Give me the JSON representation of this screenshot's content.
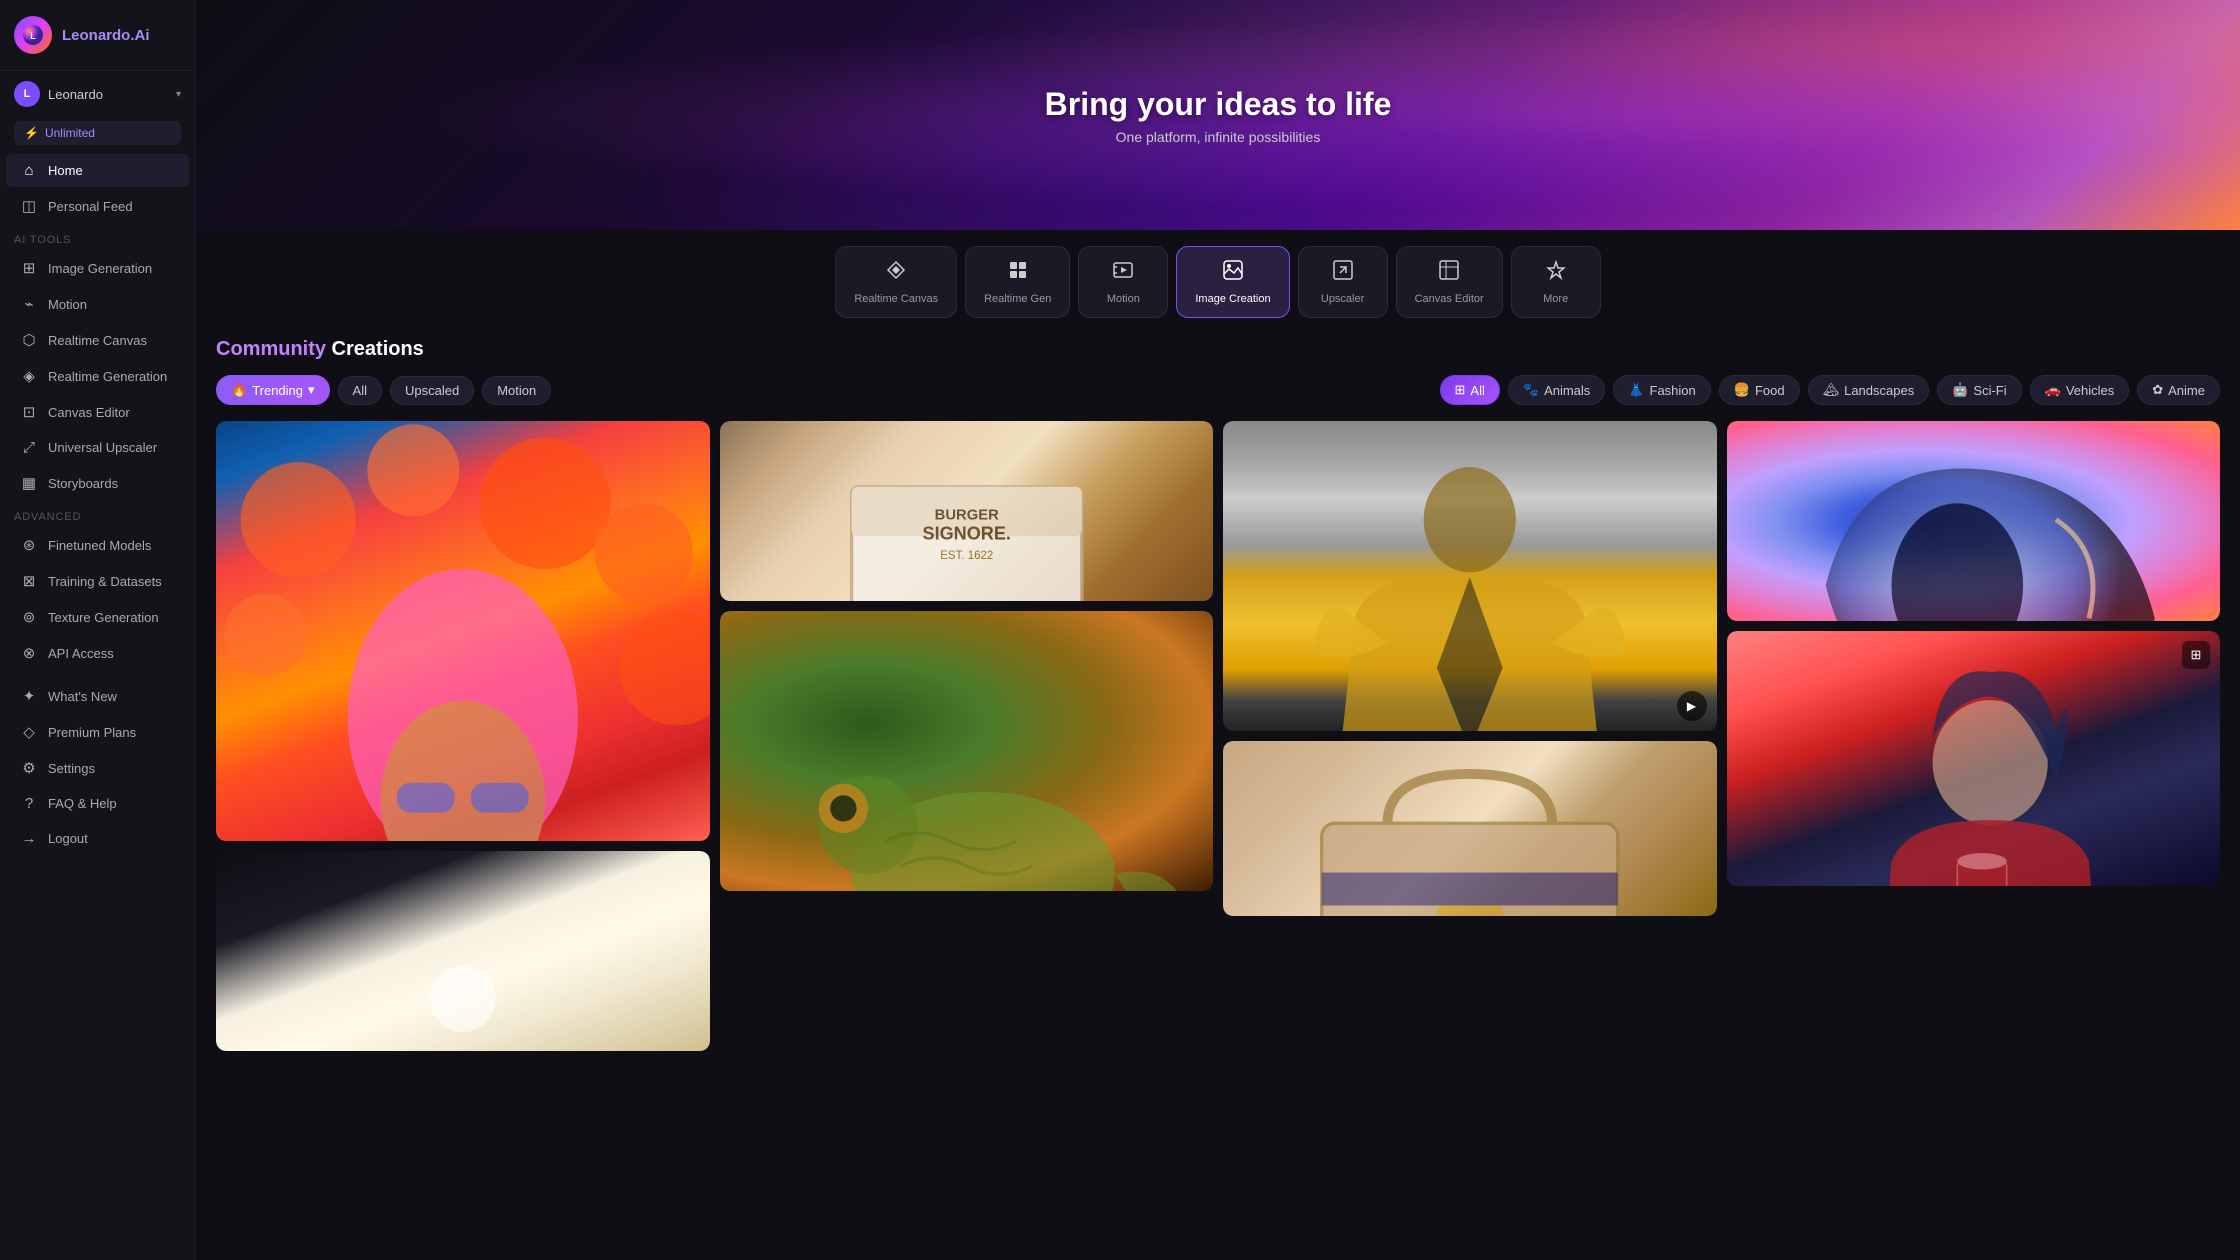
{
  "app": {
    "name": "Leonardo",
    "name_suffix": ".Ai"
  },
  "user": {
    "name": "Leonardo",
    "initials": "L",
    "plan": "Unlimited"
  },
  "sidebar": {
    "sections": [
      {
        "label": "",
        "items": [
          {
            "id": "home",
            "label": "Home",
            "icon": "⌂",
            "active": true
          },
          {
            "id": "personal-feed",
            "label": "Personal Feed",
            "icon": "◫"
          }
        ]
      },
      {
        "label": "AI Tools",
        "items": [
          {
            "id": "image-generation",
            "label": "Image Generation",
            "icon": "⊞"
          },
          {
            "id": "motion",
            "label": "Motion",
            "icon": "⌁"
          },
          {
            "id": "realtime-canvas",
            "label": "Realtime Canvas",
            "icon": "⬡"
          },
          {
            "id": "realtime-generation",
            "label": "Realtime Generation",
            "icon": "◈"
          },
          {
            "id": "canvas-editor",
            "label": "Canvas Editor",
            "icon": "⊡"
          },
          {
            "id": "universal-upscaler",
            "label": "Universal Upscaler",
            "icon": "⤢"
          },
          {
            "id": "storyboards",
            "label": "Storyboards",
            "icon": "▦"
          }
        ]
      },
      {
        "label": "Advanced",
        "items": [
          {
            "id": "finetuned-models",
            "label": "Finetuned Models",
            "icon": "⊛"
          },
          {
            "id": "training-datasets",
            "label": "Training & Datasets",
            "icon": "⊠"
          },
          {
            "id": "texture-generation",
            "label": "Texture Generation",
            "icon": "⊚"
          },
          {
            "id": "api-access",
            "label": "API Access",
            "icon": "⊗"
          }
        ]
      },
      {
        "label": "",
        "items": [
          {
            "id": "whats-new",
            "label": "What's New",
            "icon": "✦"
          },
          {
            "id": "premium-plans",
            "label": "Premium Plans",
            "icon": "◇"
          },
          {
            "id": "settings",
            "label": "Settings",
            "icon": "⚙"
          },
          {
            "id": "faq-help",
            "label": "FAQ & Help",
            "icon": "?"
          },
          {
            "id": "logout",
            "label": "Logout",
            "icon": "→"
          }
        ]
      }
    ]
  },
  "hero": {
    "title": "Bring your ideas to life",
    "subtitle": "One platform, infinite possibilities"
  },
  "toolbar": {
    "items": [
      {
        "id": "realtime-canvas",
        "label": "Realtime Canvas",
        "icon": "⚡"
      },
      {
        "id": "realtime-gen",
        "label": "Realtime Gen",
        "icon": "⊞"
      },
      {
        "id": "motion",
        "label": "Motion",
        "icon": "▶"
      },
      {
        "id": "image-creation",
        "label": "Image Creation",
        "icon": "⊟",
        "active": true
      },
      {
        "id": "upscaler",
        "label": "Upscaler",
        "icon": "⤢"
      },
      {
        "id": "canvas-editor",
        "label": "Canvas Editor",
        "icon": "⊡"
      },
      {
        "id": "more",
        "label": "More",
        "icon": "✦"
      }
    ]
  },
  "community": {
    "title_highlight": "Community",
    "title_rest": " Creations",
    "filters_left": [
      {
        "id": "trending",
        "label": "Trending",
        "icon": "🔥",
        "type": "trending"
      },
      {
        "id": "all-left",
        "label": "All",
        "type": "secondary"
      },
      {
        "id": "upscaled",
        "label": "Upscaled",
        "type": "secondary"
      },
      {
        "id": "motion",
        "label": "Motion",
        "type": "secondary"
      }
    ],
    "filters_right": [
      {
        "id": "all-right",
        "label": "All",
        "icon": "⊞",
        "type": "active-pill"
      },
      {
        "id": "animals",
        "label": "Animals",
        "icon": "🐾",
        "type": "secondary"
      },
      {
        "id": "fashion",
        "label": "Fashion",
        "icon": "👗",
        "type": "secondary"
      },
      {
        "id": "food",
        "label": "Food",
        "icon": "🍔",
        "type": "secondary"
      },
      {
        "id": "landscapes",
        "label": "Landscapes",
        "icon": "🏔",
        "type": "secondary"
      },
      {
        "id": "sci-fi",
        "label": "Sci-Fi",
        "icon": "🤖",
        "type": "secondary"
      },
      {
        "id": "vehicles",
        "label": "Vehicles",
        "icon": "🚗",
        "type": "secondary"
      },
      {
        "id": "anime",
        "label": "Anime",
        "icon": "✿",
        "type": "secondary"
      }
    ]
  }
}
